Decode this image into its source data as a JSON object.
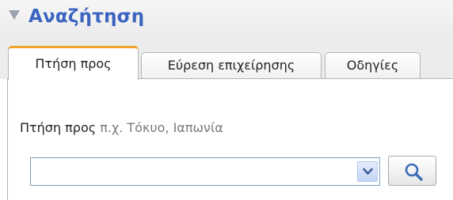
{
  "header": {
    "title": "Αναζήτηση"
  },
  "tabs": [
    {
      "label": "Πτήση προς",
      "active": true
    },
    {
      "label": "Εύρεση επιχείρησης",
      "active": false
    },
    {
      "label": "Οδηγίες",
      "active": false
    }
  ],
  "fly_to": {
    "label": "Πτήση προς",
    "hint": "π.χ. Τόκυο, Ιαπωνία",
    "input_value": ""
  },
  "icons": {
    "collapse": "triangle-down-icon",
    "dropdown": "chevron-down-icon",
    "search": "magnifier-icon"
  },
  "colors": {
    "title": "#3a64c0",
    "active_tab_accent": "#f1a32a"
  }
}
